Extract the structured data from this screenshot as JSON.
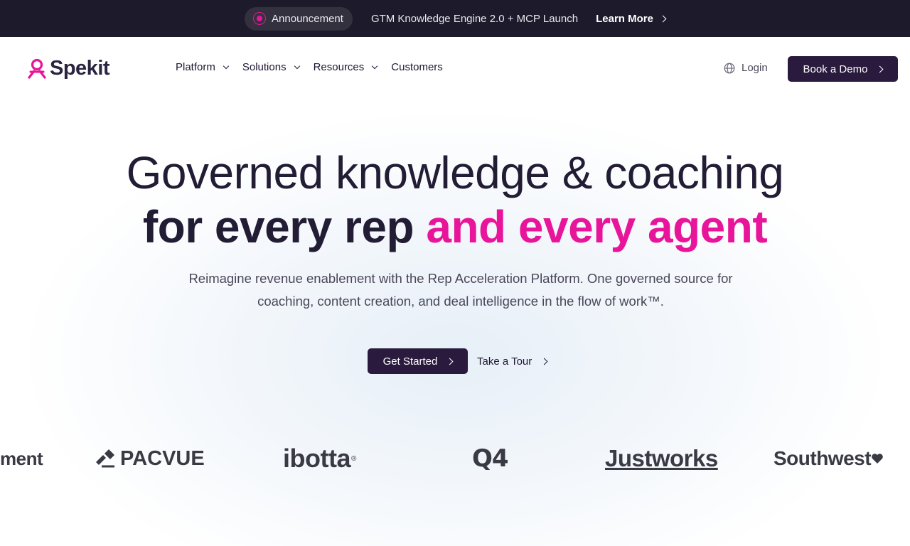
{
  "announcement": {
    "pill_label": "Announcement",
    "text": "GTM Knowledge Engine 2.0 + MCP Launch",
    "link_label": "Learn More"
  },
  "nav": {
    "logo_text": "Spekit",
    "items": [
      {
        "label": "Platform",
        "has_dropdown": true
      },
      {
        "label": "Solutions",
        "has_dropdown": true
      },
      {
        "label": "Resources",
        "has_dropdown": true
      },
      {
        "label": "Customers",
        "has_dropdown": false
      }
    ],
    "login_label": "Login",
    "demo_label": "Book a Demo"
  },
  "hero": {
    "title_line1": "Governed knowledge & coaching",
    "title_line2_plain": "for every rep ",
    "title_line2_accent": "and every agent",
    "subtitle": "Reimagine revenue enablement with the Rep Acceleration Platform. One governed source for coaching, content creation, and deal intelligence in the flow of work™.",
    "primary_cta": "Get Started",
    "secondary_cta": "Take a Tour"
  },
  "customer_logos": [
    "ment",
    "PACVUE",
    "ibotta",
    "Q4",
    "Justworks",
    "Southwest"
  ],
  "colors": {
    "accent": "#e8149a",
    "dark": "#2a1a3d",
    "announcement_bg": "#1c1a2b"
  }
}
